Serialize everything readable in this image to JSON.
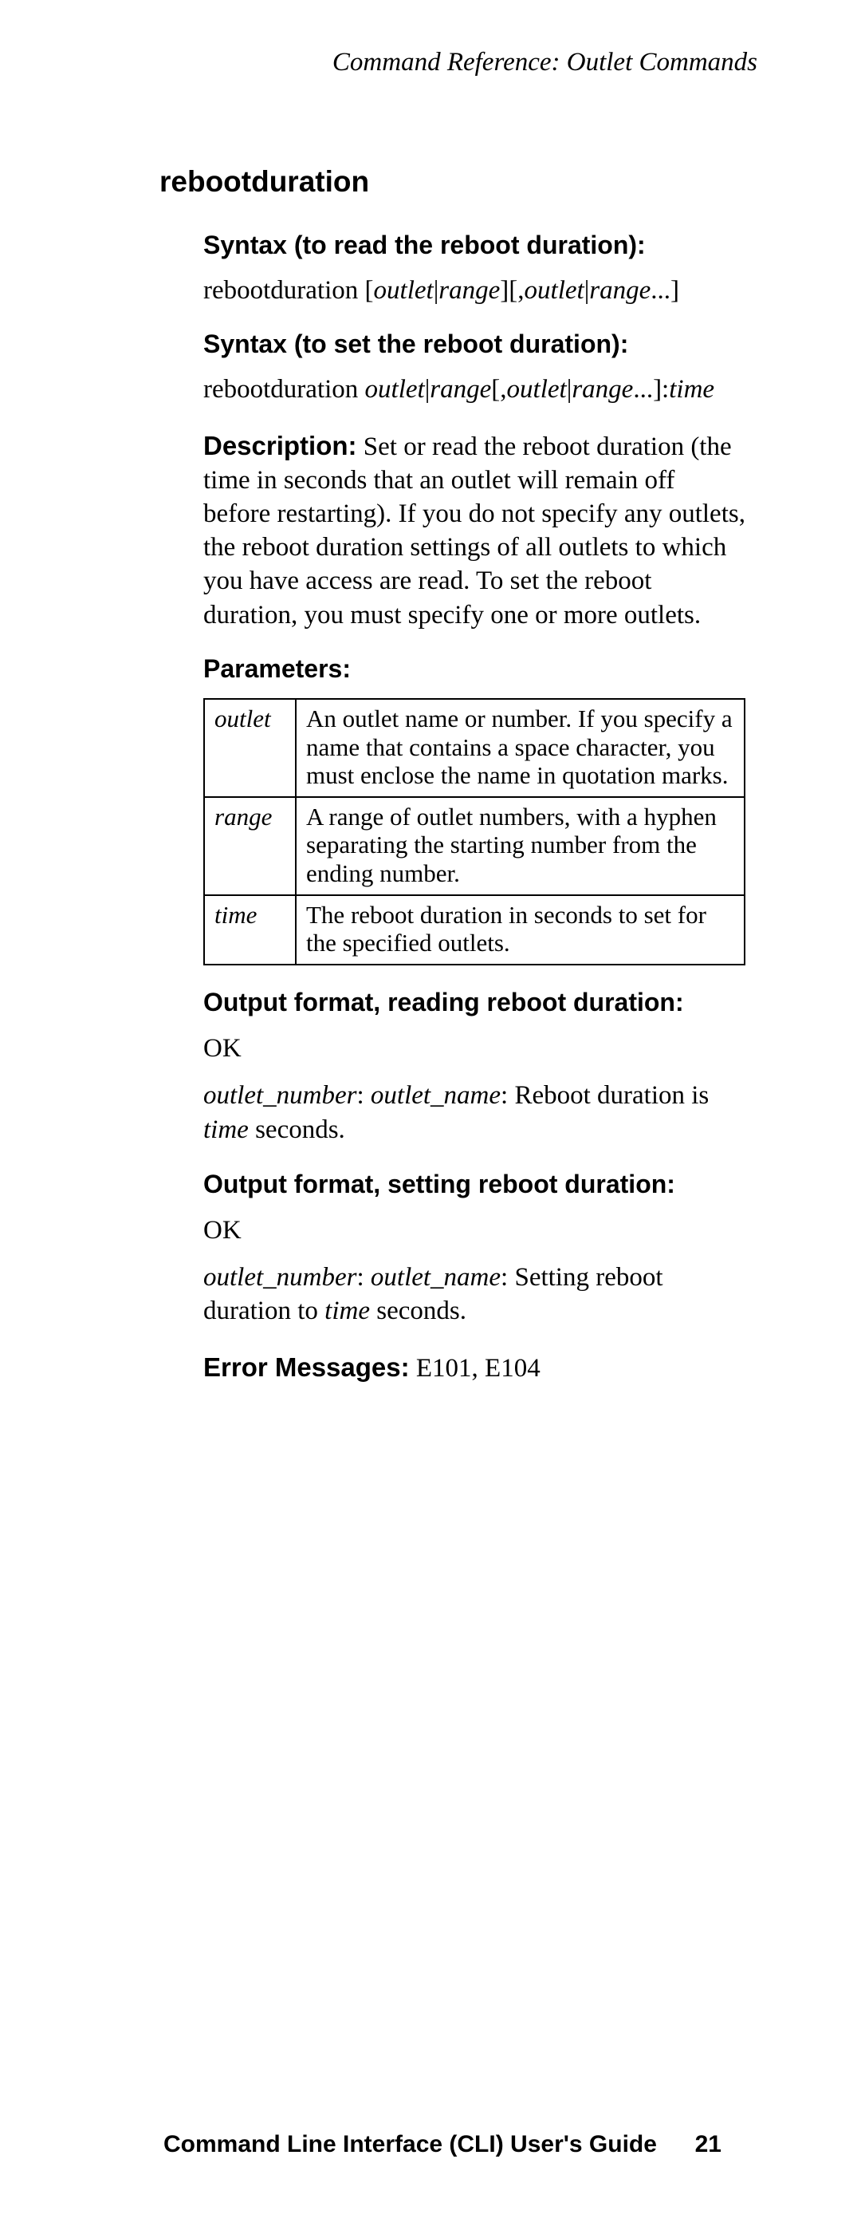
{
  "header": "Command Reference: Outlet Commands",
  "command": "rebootduration",
  "syntax_read": {
    "heading": "Syntax (to read the reboot duration):",
    "cmd": "rebootduration",
    "arg1": "outlet",
    "arg2": "range",
    "arg3": "outlet",
    "arg4": "range"
  },
  "syntax_set": {
    "heading": "Syntax (to set the reboot duration):",
    "cmd": "rebootduration",
    "arg1": "outlet",
    "arg2": "range",
    "arg3": "outlet",
    "arg4": "range",
    "arg5": "time"
  },
  "description": {
    "lead": "Description:",
    "text": " Set or read the reboot duration (the time in seconds that an outlet will remain off before restarting). If you do not specify any outlets, the reboot duration settings of all outlets to which you have access are read. To set the reboot duration, you must specify one or more outlets."
  },
  "parameters": {
    "heading": "Parameters:",
    "rows": [
      {
        "name": "outlet",
        "desc": "An outlet name or number. If you specify a name that contains a space character, you must enclose the name in quotation marks."
      },
      {
        "name": "range",
        "desc": "A range of outlet numbers, with a hyphen separating the starting number from the ending number."
      },
      {
        "name": "time",
        "desc": "The reboot duration in seconds to set for the specified outlets."
      }
    ]
  },
  "output_read": {
    "heading": "Output format, reading reboot duration:",
    "ok": "OK",
    "var1": "outlet_number",
    "var2": "outlet_name",
    "text1": ": Reboot duration is ",
    "var3": "time",
    "text2": " seconds."
  },
  "output_set": {
    "heading": "Output format, setting reboot duration:",
    "ok": "OK",
    "var1": "outlet_number",
    "var2": "outlet_name",
    "text1": ": Setting reboot duration to ",
    "var3": "time",
    "text2": " seconds."
  },
  "error": {
    "lead": "Error Messages:",
    "text": " E101, E104"
  },
  "footer": {
    "title": "Command Line Interface (CLI) User's Guide",
    "page": "21"
  }
}
